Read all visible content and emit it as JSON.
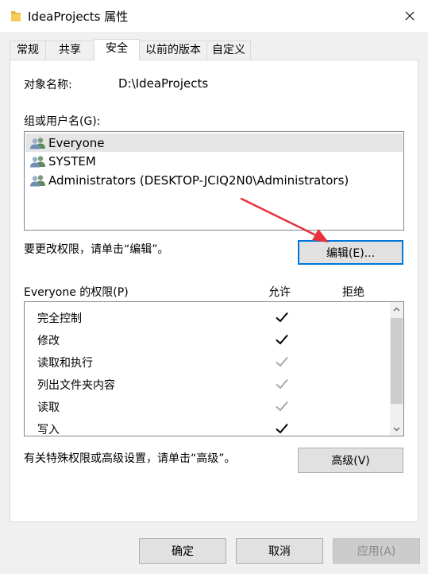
{
  "window": {
    "title": "IdeaProjects 属性"
  },
  "tabs": [
    "常规",
    "共享",
    "安全",
    "以前的版本",
    "自定义"
  ],
  "active_tab": "安全",
  "object": {
    "label": "对象名称:",
    "value": "D:\\IdeaProjects"
  },
  "groups": {
    "label": "组或用户名(G):",
    "items": [
      {
        "name": "Everyone",
        "selected": true
      },
      {
        "name": "SYSTEM",
        "selected": false
      },
      {
        "name": "Administrators (DESKTOP-JCIQ2N0\\Administrators)",
        "selected": false
      }
    ]
  },
  "edit": {
    "hint": "要更改权限，请单击“编辑”。",
    "button": "编辑(E)..."
  },
  "permissions": {
    "label": "Everyone 的权限(P)",
    "allow_header": "允许",
    "deny_header": "拒绝",
    "rows": [
      {
        "name": "完全控制",
        "allow": "explicit"
      },
      {
        "name": "修改",
        "allow": "explicit"
      },
      {
        "name": "读取和执行",
        "allow": "inherited"
      },
      {
        "name": "列出文件夹内容",
        "allow": "inherited"
      },
      {
        "name": "读取",
        "allow": "inherited"
      },
      {
        "name": "写入",
        "allow": "explicit"
      }
    ]
  },
  "advanced": {
    "hint": "有关特殊权限或高级设置，请单击“高级”。",
    "button": "高级(V)"
  },
  "footer": {
    "ok": "确定",
    "cancel": "取消",
    "apply": "应用(A)"
  },
  "colors": {
    "accent": "#0078d7",
    "annotation_arrow": "#e8313a",
    "panel": "#ffffff",
    "chrome": "#f0f0f0"
  }
}
